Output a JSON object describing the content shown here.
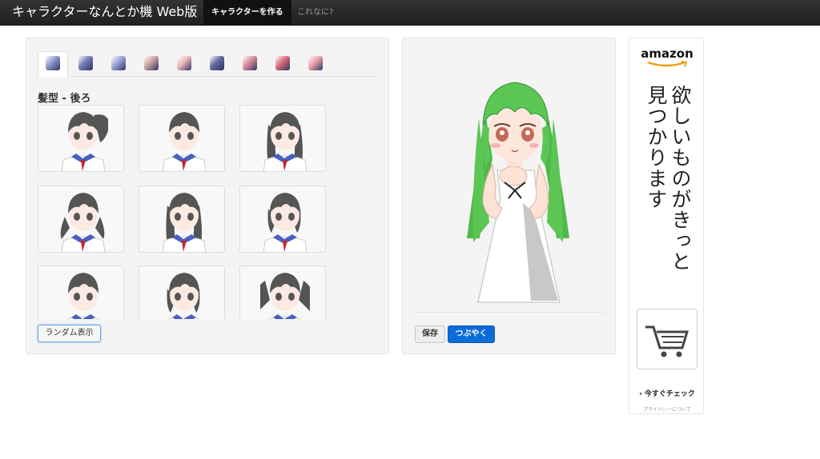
{
  "navbar": {
    "brand": "キャラクターなんとか機 Web版",
    "make_character": "キャラクターを作る",
    "what_is_this": "これなに?"
  },
  "editor": {
    "section_title": "髪型 - 後ろ",
    "random_button": "ランダム表示",
    "active_tab": 0,
    "tab_colors": [
      "#8a95c8",
      "#6f7ab8",
      "#9aa3d6",
      "#c8a0a0",
      "#e8b8b8",
      "#5e6a9e",
      "#d88a9a",
      "#d86a7a",
      "#e8a0a8"
    ]
  },
  "preview": {
    "save_button": "保存",
    "tweet_button": "つぶやく"
  },
  "ad": {
    "logo": "amazon",
    "text": "欲しいものがきっと見つかります",
    "check": "› 今すぐチェック",
    "privacy": "プライバシーについて"
  },
  "colors": {
    "accent": "#0c6cd8",
    "hair_preview": "#57c24e",
    "panel_bg": "#f4f4f4"
  }
}
